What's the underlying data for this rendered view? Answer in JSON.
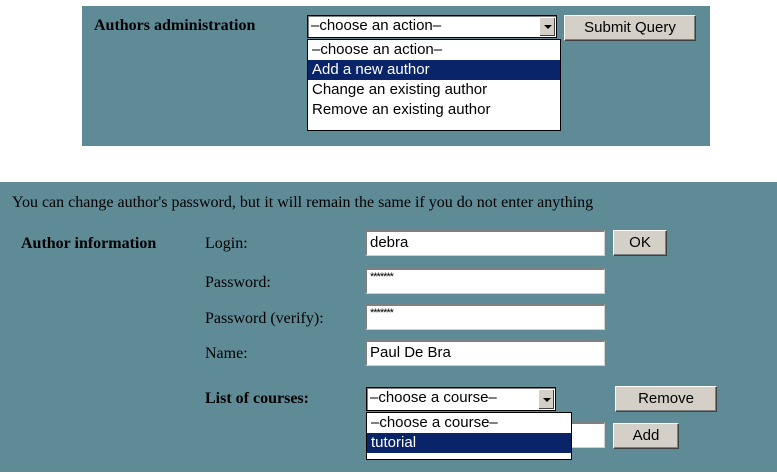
{
  "authors_admin": {
    "label": "Authors administration",
    "select_value": "–choose an action–",
    "submit_label": "Submit Query",
    "options": [
      "–choose an action–",
      "Add a new author",
      "Change an existing author",
      "Remove an existing author"
    ],
    "selected_option_index": 1
  },
  "author_form": {
    "note": "You can change author's password, but it will remain the same if you do not enter anything",
    "section_label": "Author information",
    "login_label": "Login:",
    "login_value": "debra",
    "ok_label": "OK",
    "password_label": "Password:",
    "password_value": "*******",
    "password_verify_label": "Password (verify):",
    "password_verify_value": "*******",
    "name_label": "Name:",
    "name_value": "Paul De Bra",
    "courses_label": "List of courses:",
    "course_select_value": "–choose a course–",
    "remove_label": "Remove",
    "add_label": "Add",
    "course_options": [
      "–choose a course–",
      "tutorial"
    ],
    "selected_course_index": 1
  },
  "colors": {
    "panel": "#5f8b97",
    "selection": "#0a246a",
    "button": "#d4d0c8"
  }
}
